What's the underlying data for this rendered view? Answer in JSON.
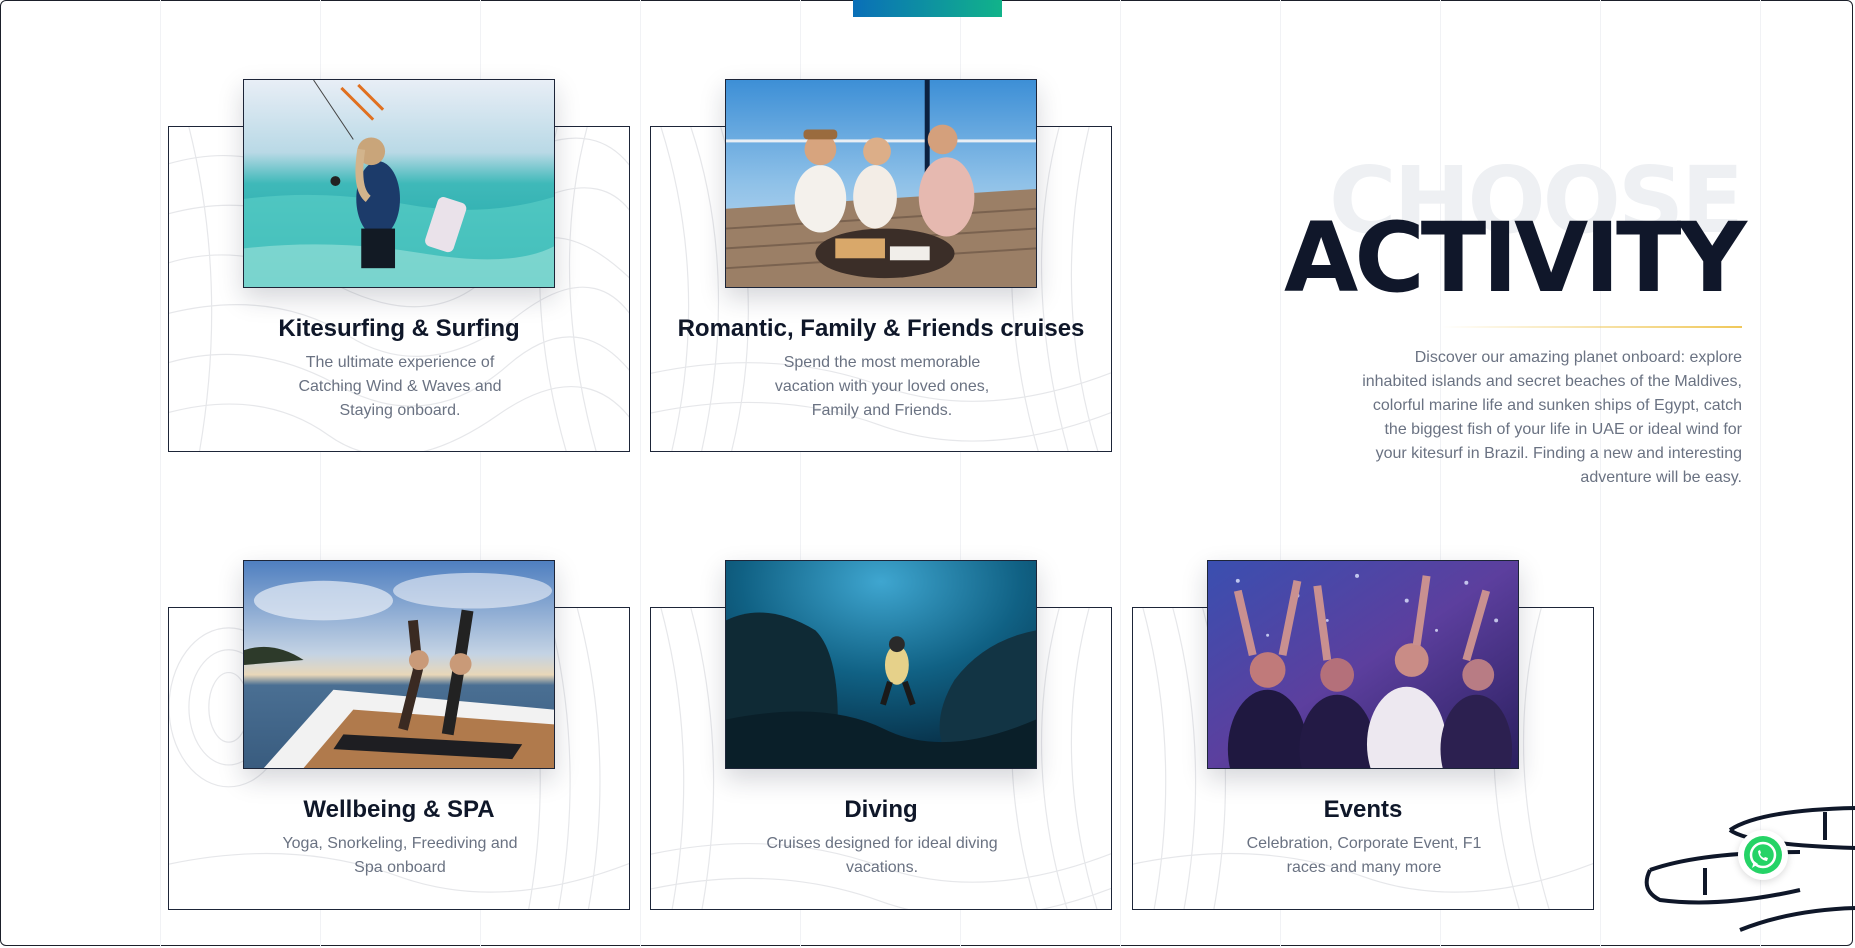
{
  "section": {
    "title_bg": "CHOOSE",
    "title": "ACTIVITY",
    "intro": "Discover our amazing planet onboard: explore inhabited islands and secret beaches of the Maldives, colorful marine life and sunken ships of Egypt, catch the biggest fish of your life in UAE or ideal wind for your kitesurf in Brazil. Finding a new and interesting adventure will be easy."
  },
  "cards": [
    {
      "title": "Kitesurfing & Surfing",
      "desc": "The ultimate experience of Catching Wind & Waves and Staying onboard.",
      "image": "kitesurfer-in-sea-photo"
    },
    {
      "title": "Romantic, Family & Friends cruises",
      "desc": "Spend the most memorable vacation with your loved ones, Family and Friends.",
      "image": "friends-on-yacht-photo"
    },
    {
      "title": "Wellbeing & SPA",
      "desc": "Yoga, Snorkeling, Freediving and Spa onboard",
      "image": "yoga-on-deck-photo"
    },
    {
      "title": "Diving",
      "desc": "Cruises designed for ideal diving vacations.",
      "image": "diver-underwater-photo"
    },
    {
      "title": "Events",
      "desc": "Celebration, Corporate Event, F1 races and many more",
      "image": "party-crowd-photo"
    }
  ],
  "widget": {
    "icon": "whatsapp-icon"
  },
  "colors": {
    "accent_from": "#0a6fb8",
    "accent_to": "#11b38a",
    "heading": "#10172a",
    "text": "#6a7282",
    "gold": "#f0c85a",
    "whatsapp": "#25d366"
  }
}
